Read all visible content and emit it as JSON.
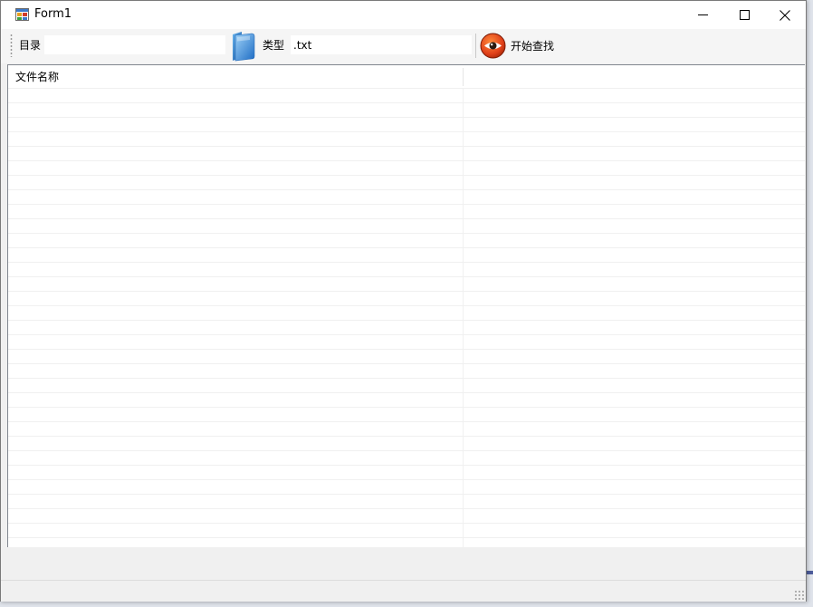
{
  "window": {
    "title": "Form1",
    "icon": "form-app-icon",
    "controls": [
      "minimize-icon",
      "maximize-icon",
      "close-icon"
    ]
  },
  "toolbar": {
    "directory_label": "目录",
    "directory_value": "",
    "folder_icon": "folder-icon",
    "type_label": "类型",
    "type_value": ".txt",
    "search_icon": "eye-icon",
    "search_label": "开始查找"
  },
  "listview": {
    "columns": [
      "文件名称",
      ""
    ],
    "rows": []
  },
  "statusbar": {
    "text": ""
  }
}
